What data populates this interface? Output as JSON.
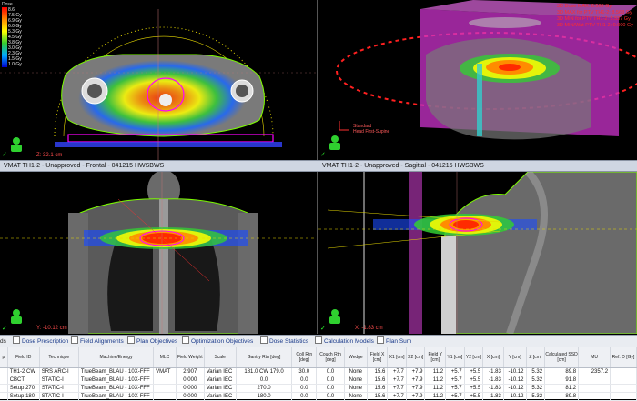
{
  "dose_legend": {
    "title": "Dose",
    "levels": [
      "8.6",
      "7.5 Gy",
      "6.9 Gy",
      "6.0 Gy",
      "5.3 Gy",
      "4.5 Gy",
      "3.8 Gy",
      "3.0 Gy",
      "2.3 Gy",
      "1.5 Gy",
      "1.0 Gy",
      "0.8 Gy"
    ]
  },
  "dvh_labels": [
    "3D Dose MAX: 8.568 Gy",
    "3D MAX for PTV TH1-2: 8.568 Gy",
    "3D MIN for PTV TH1-2: 5.537 Gy",
    "3D MIN/Wat PTV TH1-2: 0.000 Gy"
  ],
  "orientation_3d": [
    "Standard",
    "Head First-Supine"
  ],
  "view_bars": {
    "frontal": "VMAT TH1-2  -  Unapproved - Frontal - 041215 HWSBWS",
    "sagittal": "VMAT TH1-2  -  Unapproved - Sagittal - 041215 HWSBWS"
  },
  "positions": {
    "transversal": "Z: 32.1 cm",
    "frontal": "Y: -10.12 cm",
    "sagittal": "X: -1.83 cm"
  },
  "tabs": [
    "Dose Prescription",
    "Field Alignments",
    "Plan Objectives",
    "Optimization Objectives",
    "Dose Statistics",
    "Calculation Models",
    "Plan Sum"
  ],
  "tab_prefix": "ds",
  "columns": [
    "p",
    "Field ID",
    "Technique",
    "Machine/Energy",
    "MLC",
    "Field Weight",
    "Scale",
    "Gantry Rtn [deg]",
    "Coll Rtn [deg]",
    "Couch Rtn [deg]",
    "Wedge",
    "Field X [cm]",
    "X1 [cm]",
    "X2 [cm]",
    "Field Y [cm]",
    "Y1 [cm]",
    "Y2 [cm]",
    "X [cm]",
    "Y [cm]",
    "Z [cm]",
    "Calculated SSD [cm]",
    "MU",
    "Ref. D [Gy]"
  ],
  "rows": [
    [
      "",
      "TH1-2 CW",
      "SRS ARC-I",
      "TrueBeam_BLAU - 10X-FFF",
      "VMAT",
      "2.907",
      "Varian IEC",
      "181.0 CW 179.0",
      "30.0",
      "0.0",
      "None",
      "15.6",
      "+7.7",
      "+7.9",
      "11.2",
      "+5.7",
      "+5.5",
      "-1.83",
      "-10.12",
      "5.32",
      "89.8",
      "2357.2",
      ""
    ],
    [
      "",
      "CBCT",
      "STATIC-I",
      "TrueBeam_BLAU - 10X-FFF",
      "",
      "0.000",
      "Varian IEC",
      "0.0",
      "0.0",
      "0.0",
      "None",
      "15.6",
      "+7.7",
      "+7.9",
      "11.2",
      "+5.7",
      "+5.5",
      "-1.83",
      "-10.12",
      "5.32",
      "91.8",
      "",
      ""
    ],
    [
      "",
      "Setup 270",
      "STATIC-I",
      "TrueBeam_BLAU - 10X-FFF",
      "",
      "0.000",
      "Varian IEC",
      "270.0",
      "0.0",
      "0.0",
      "None",
      "15.6",
      "+7.7",
      "+7.9",
      "11.2",
      "+5.7",
      "+5.5",
      "-1.83",
      "-10.12",
      "5.32",
      "81.2",
      "",
      ""
    ],
    [
      "",
      "Setup 180",
      "STATIC-I",
      "TrueBeam_BLAU - 10X-FFF",
      "",
      "0.000",
      "Varian IEC",
      "180.0",
      "0.0",
      "0.0",
      "None",
      "15.6",
      "+7.7",
      "+7.9",
      "11.2",
      "+5.7",
      "+5.5",
      "-1.83",
      "-10.12",
      "5.32",
      "89.8",
      "",
      ""
    ]
  ],
  "colors": {
    "dose_red": "#ff2a00",
    "dose_orange": "#ff9900",
    "dose_yellow": "#ffff00",
    "dose_green": "#33cc33",
    "dose_blue": "#1a4cff",
    "body_contour": "#7CFC00",
    "ptv_magenta": "#ff00ff"
  }
}
